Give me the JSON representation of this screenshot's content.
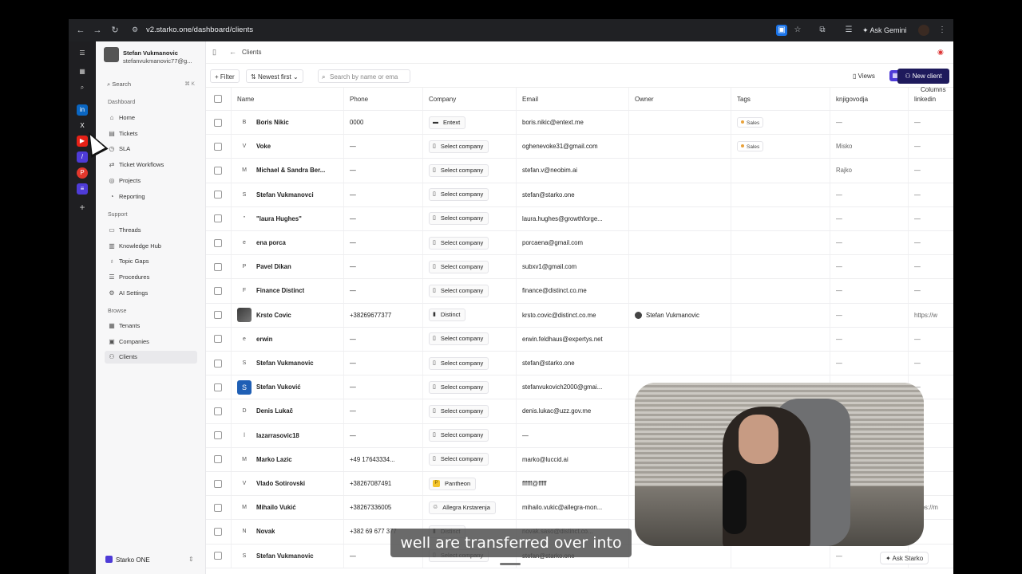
{
  "browser": {
    "url": "v2.starko.one/dashboard/clients",
    "ask_gemini": "Ask Gemini"
  },
  "sidebar": {
    "user_name": "Stefan Vukmanovic",
    "user_email": "stefanvukmanovic77@g...",
    "search_placeholder": "Search",
    "search_shortcut": "⌘ K",
    "sections": {
      "dashboard": "Dashboard",
      "support": "Support",
      "browse": "Browse"
    },
    "dashboard_items": [
      {
        "label": "Home",
        "icon": "home-icon",
        "glyph": "⌂"
      },
      {
        "label": "Tickets",
        "icon": "ticket-icon",
        "glyph": "▤"
      },
      {
        "label": "SLA",
        "icon": "sla-icon",
        "glyph": "◷"
      },
      {
        "label": "Ticket Workflows",
        "icon": "workflow-icon",
        "glyph": "⇄"
      },
      {
        "label": "Projects",
        "icon": "projects-icon",
        "glyph": "◎"
      },
      {
        "label": "Reporting",
        "icon": "reporting-icon",
        "glyph": "◔"
      }
    ],
    "support_items": [
      {
        "label": "Threads",
        "icon": "threads-icon",
        "glyph": "▭"
      },
      {
        "label": "Knowledge Hub",
        "icon": "knowledge-icon",
        "glyph": "▥"
      },
      {
        "label": "Topic Gaps",
        "icon": "topic-gaps-icon",
        "glyph": "♁"
      },
      {
        "label": "Procedures",
        "icon": "procedures-icon",
        "glyph": "☰"
      },
      {
        "label": "AI Settings",
        "icon": "ai-settings-icon",
        "glyph": "⚙"
      }
    ],
    "browse_items": [
      {
        "label": "Tenants",
        "icon": "tenants-icon",
        "glyph": "▦"
      },
      {
        "label": "Companies",
        "icon": "companies-icon",
        "glyph": "▣"
      },
      {
        "label": "Clients",
        "icon": "clients-icon",
        "glyph": "⚇"
      }
    ],
    "org_name": "Starko ONE"
  },
  "topbar": {
    "breadcrumb": "Clients"
  },
  "toolbar": {
    "filter": "Filter",
    "sort": "Newest first",
    "search_placeholder": "Search by name or ema",
    "views": "Views",
    "columns": "Columns",
    "new_client": "New client"
  },
  "table": {
    "headers": [
      "Name",
      "Phone",
      "Company",
      "Email",
      "Owner",
      "Tags",
      "knjigovodja",
      "linkedin"
    ],
    "rows": [
      {
        "initial": "B",
        "name": "Boris Nikic",
        "phone": "0000",
        "company": "Entext",
        "company_icon": "entext",
        "email": "boris.nikic@entext.me",
        "owner": "",
        "tag": "Sales",
        "knjigovodja": "—",
        "linkedin": "—"
      },
      {
        "initial": "V",
        "name": "Voke",
        "phone": "—",
        "company": "Select company",
        "company_icon": "select",
        "email": "oghenevoke31@gmail.com",
        "owner": "",
        "tag": "Sales",
        "knjigovodja": "Misko",
        "linkedin": "—"
      },
      {
        "initial": "M",
        "name": "Michael & Sandra Ber...",
        "phone": "—",
        "company": "Select company",
        "company_icon": "select",
        "email": "stefan.v@neobim.ai",
        "owner": "",
        "tag": "",
        "knjigovodja": "Rajko",
        "linkedin": "—"
      },
      {
        "initial": "S",
        "name": "Stefan Vukmanovci",
        "phone": "—",
        "company": "Select company",
        "company_icon": "select",
        "email": "stefan@starko.one",
        "owner": "",
        "tag": "",
        "knjigovodja": "—",
        "linkedin": "—"
      },
      {
        "initial": "\"",
        "name": "\"laura Hughes\"",
        "phone": "—",
        "company": "Select company",
        "company_icon": "select",
        "email": "laura.hughes@growthforge...",
        "owner": "",
        "tag": "",
        "knjigovodja": "—",
        "linkedin": "—"
      },
      {
        "initial": "e",
        "name": "ena porca",
        "phone": "—",
        "company": "Select company",
        "company_icon": "select",
        "email": "porcaena@gmail.com",
        "owner": "",
        "tag": "",
        "knjigovodja": "—",
        "linkedin": "—"
      },
      {
        "initial": "P",
        "name": "Pavel Dikan",
        "phone": "—",
        "company": "Select company",
        "company_icon": "select",
        "email": "subxv1@gmail.com",
        "owner": "",
        "tag": "",
        "knjigovodja": "—",
        "linkedin": "—"
      },
      {
        "initial": "F",
        "name": "Finance Distinct",
        "phone": "—",
        "company": "Select company",
        "company_icon": "select",
        "email": "finance@distinct.co.me",
        "owner": "",
        "tag": "",
        "knjigovodja": "—",
        "linkedin": "—"
      },
      {
        "initial": "",
        "avatar": "photo",
        "name": "Krsto Covic",
        "phone": "+38269677377",
        "company": "Distinct",
        "company_icon": "distinct",
        "email": "krsto.covic@distinct.co.me",
        "owner": "Stefan Vukmanovic",
        "tag": "",
        "knjigovodja": "—",
        "linkedin": "https://w"
      },
      {
        "initial": "e",
        "name": "erwin",
        "phone": "—",
        "company": "Select company",
        "company_icon": "select",
        "email": "erwin.feldhaus@expertys.net",
        "owner": "",
        "tag": "",
        "knjigovodja": "—",
        "linkedin": "—"
      },
      {
        "initial": "S",
        "name": "Stefan Vukmanovic",
        "phone": "—",
        "company": "Select company",
        "company_icon": "select",
        "email": "stefan@starko.one",
        "owner": "",
        "tag": "",
        "knjigovodja": "—",
        "linkedin": "—"
      },
      {
        "initial": "S",
        "avatar": "blue",
        "name": "Stefan Vuković",
        "phone": "—",
        "company": "Select company",
        "company_icon": "select",
        "email": "stefanvukovich2000@gmai...",
        "owner": "",
        "tag": "",
        "knjigovodja": "—",
        "linkedin": "—"
      },
      {
        "initial": "D",
        "name": "Denis Lukač",
        "phone": "—",
        "company": "Select company",
        "company_icon": "select",
        "email": "denis.lukac@uzz.gov.me",
        "owner": "",
        "tag": "",
        "knjigovodja": "—",
        "linkedin": "—"
      },
      {
        "initial": "l",
        "name": "lazarrasovic18",
        "phone": "—",
        "company": "Select company",
        "company_icon": "select",
        "email": "—",
        "owner": "",
        "tag": "",
        "knjigovodja": "—",
        "linkedin": "—"
      },
      {
        "initial": "M",
        "name": "Marko Lazic",
        "phone": "+49 17643334...",
        "company": "Select company",
        "company_icon": "select",
        "email": "marko@luccid.ai",
        "owner": "",
        "tag": "",
        "knjigovodja": "—",
        "linkedin": "—"
      },
      {
        "initial": "V",
        "name": "Vlado Sotirovski",
        "phone": "+38267087491",
        "company": "Pantheon",
        "company_icon": "pantheon",
        "email": "ffffff@fffff",
        "owner": "",
        "tag": "",
        "knjigovodja": "—",
        "linkedin": "—"
      },
      {
        "initial": "M",
        "name": "Mihailo Vukić",
        "phone": "+38267336005",
        "company": "Allegra Krstarenja",
        "company_icon": "allegra",
        "email": "mihailo.vukic@allegra-mon...",
        "owner": "",
        "tag": "",
        "knjigovodja": "—",
        "linkedin": "https://m"
      },
      {
        "initial": "N",
        "name": "Novak",
        "phone": "+382 69 677 377",
        "company": "Distinct",
        "company_icon": "distinct",
        "email": "novak.saso@distinct.co...",
        "owner": "",
        "tag": "",
        "knjigovodja": "—",
        "linkedin": "—"
      },
      {
        "initial": "S",
        "name": "Stefan Vukmanovic",
        "phone": "—",
        "company": "Select company",
        "company_icon": "select",
        "email": "stefan@starko.one",
        "owner": "",
        "tag": "",
        "knjigovodja": "—",
        "linkedin": "—"
      }
    ]
  },
  "caption": "well are transferred over into",
  "ask_starko": "Ask Starko",
  "colors": {
    "accent": "#4e3bd7",
    "primary_button": "#1e1a5c",
    "tag_dot": "#e9a23b"
  }
}
